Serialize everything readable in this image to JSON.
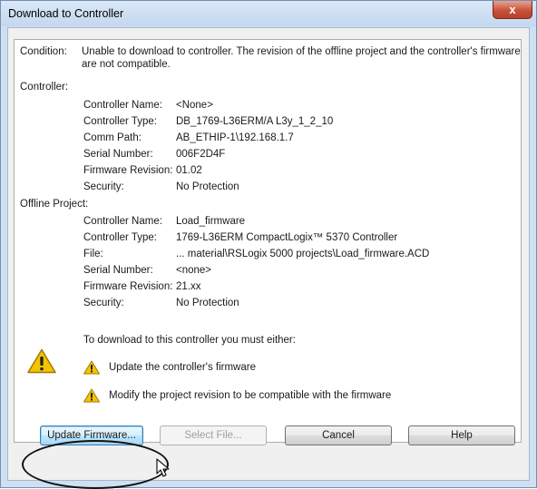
{
  "window": {
    "title": "Download to Controller",
    "close_glyph": "x"
  },
  "condition": {
    "label": "Condition:",
    "line1": "Unable to download to controller. The revision of the offline project and the controller's firmware",
    "line2": "are not compatible."
  },
  "controller": {
    "heading": "Controller:",
    "rows": [
      {
        "label": "Controller Name:",
        "value": "<None>"
      },
      {
        "label": "Controller Type:",
        "value": "DB_1769-L36ERM/A L3y_1_2_10"
      },
      {
        "label": "Comm Path:",
        "value": "AB_ETHIP-1\\192.168.1.7"
      },
      {
        "label": "Serial Number:",
        "value": "006F2D4F"
      },
      {
        "label": "Firmware Revision:",
        "value": "01.02"
      },
      {
        "label": "Security:",
        "value": "No Protection"
      }
    ]
  },
  "offline_project": {
    "heading": "Offline Project:",
    "rows": [
      {
        "label": "Controller Name:",
        "value": "Load_firmware"
      },
      {
        "label": "Controller Type:",
        "value": "1769-L36ERM CompactLogix™ 5370 Controller"
      },
      {
        "label": "File:",
        "value": "... material\\RSLogix 5000 projects\\Load_firmware.ACD"
      },
      {
        "label": "Serial Number:",
        "value": "<none>"
      },
      {
        "label": "Firmware Revision:",
        "value": "21.xx"
      },
      {
        "label": "Security:",
        "value": "No Protection"
      }
    ]
  },
  "instructions": {
    "intro": "To download to this controller you must either:",
    "options": [
      "Update the controller's firmware",
      "Modify the project revision to be compatible with the firmware"
    ]
  },
  "buttons": {
    "update_firmware": "Update Firmware...",
    "select_file": "Select File...",
    "cancel": "Cancel",
    "help": "Help"
  },
  "icons": {
    "warning": "warning-triangle-icon",
    "cursor": "mouse-pointer-icon",
    "close": "close-x-icon"
  },
  "colors": {
    "warning_fill": "#f5c400",
    "warning_border": "#a07800",
    "default_button_border": "#3c7fb1"
  }
}
